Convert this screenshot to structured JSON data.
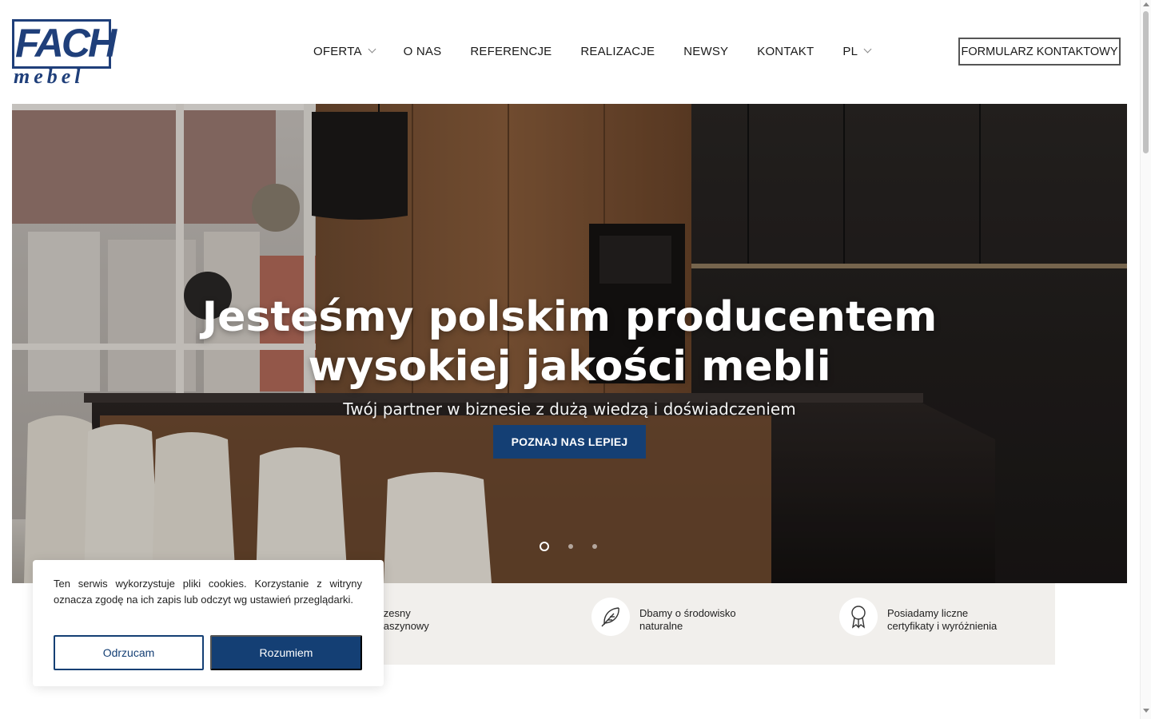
{
  "brand": {
    "logo_main": "FACH",
    "logo_sub": "mebel",
    "color": "#1f3f7a"
  },
  "nav": {
    "items": [
      {
        "label": "OFERTA",
        "has_dropdown": true
      },
      {
        "label": "O NAS",
        "has_dropdown": false
      },
      {
        "label": "REFERENCJE",
        "has_dropdown": false
      },
      {
        "label": "REALIZACJE",
        "has_dropdown": false
      },
      {
        "label": "NEWSY",
        "has_dropdown": false
      },
      {
        "label": "KONTAKT",
        "has_dropdown": false
      },
      {
        "label": "PL",
        "has_dropdown": true
      }
    ],
    "cta_label": "FORMULARZ KONTAKTOWY"
  },
  "hero": {
    "title_line1": "Jesteśmy polskim producentem",
    "title_line2": "wysokiej jakości mebli",
    "subtitle": "Twój partner w biznesie z dużą wiedzą i doświadczeniem",
    "button_label": "POZNAJ NAS LEPIEJ",
    "slides_total": 3,
    "active_slide": 1,
    "accent_color": "#143f74"
  },
  "features": [
    {
      "icon": "machine-icon",
      "text": "Nowoczesny\npark maszynowy"
    },
    {
      "icon": "feather-icon",
      "text": "Dbamy o środowisko\nnaturalne"
    },
    {
      "icon": "award-ribbon-icon",
      "text": "Posiadamy liczne\ncertyfikaty i wyróżnienia"
    }
  ],
  "cookie": {
    "text": "Ten serwis wykorzystuje pliki cookies. Korzystanie z witryny oznacza zgodę na ich zapis lub odczyt wg ustawień przeglądarki.",
    "reject_label": "Odrzucam",
    "accept_label": "Rozumiem"
  }
}
